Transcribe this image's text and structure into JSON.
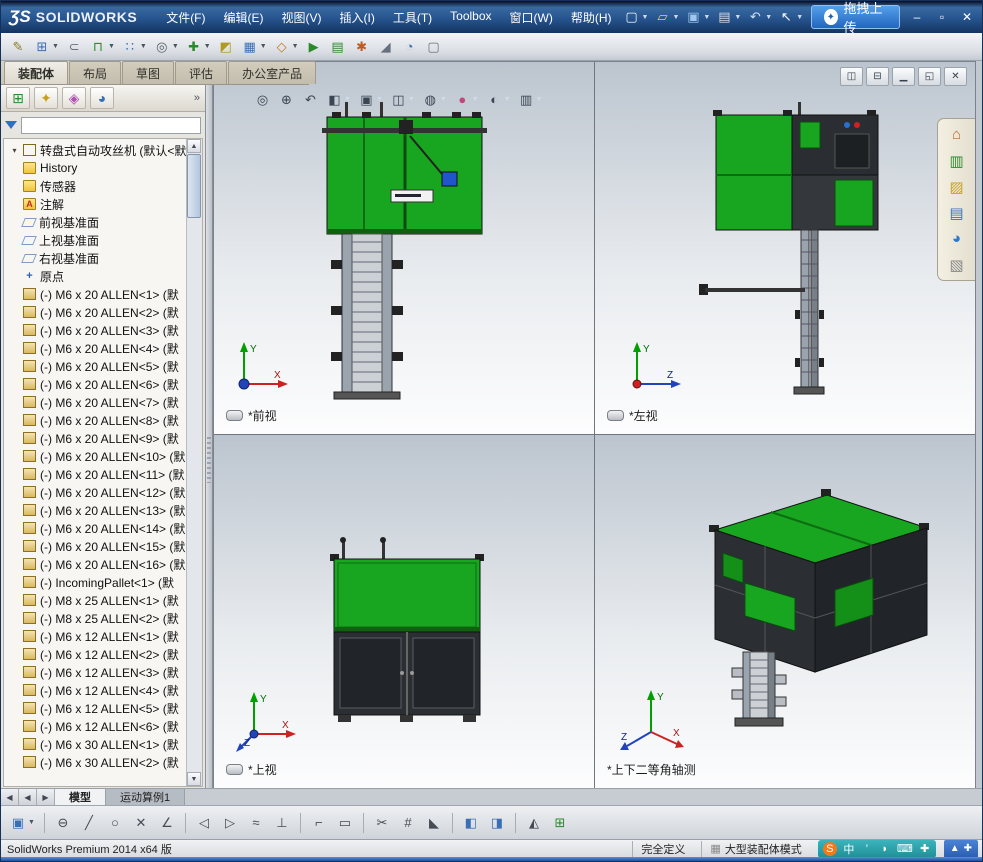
{
  "axes": {
    "x": "X",
    "y": "Y",
    "z": "Z"
  },
  "titlebar": {
    "logo": "ƷS",
    "brand": "SOLIDWORKS",
    "menus": [
      "文件(F)",
      "编辑(E)",
      "视图(V)",
      "插入(I)",
      "工具(T)",
      "Toolbox",
      "窗口(W)",
      "帮助(H)"
    ],
    "quick_tools": [
      {
        "name": "new-document-icon",
        "glyph": "▢",
        "color": "#eef2f8",
        "dropdown": true
      },
      {
        "name": "open-icon",
        "glyph": "▱",
        "color": "#f2cf6a",
        "dropdown": true
      },
      {
        "name": "save-icon",
        "glyph": "▣",
        "color": "#9ec6ee",
        "dropdown": true
      },
      {
        "name": "print-icon",
        "glyph": "▤",
        "color": "#d4dae2",
        "dropdown": true
      },
      {
        "name": "undo-icon",
        "glyph": "↶",
        "color": "#cfe0f2",
        "dropdown": true
      },
      {
        "name": "select-arrow-icon",
        "glyph": "↖",
        "color": "#ffffff",
        "dropdown": true
      }
    ],
    "upload": {
      "label": "拖拽上传",
      "logo_glyph": "✦"
    },
    "window_controls": [
      {
        "name": "minimize-button",
        "glyph": "–"
      },
      {
        "name": "maximize-button",
        "glyph": "▫"
      },
      {
        "name": "close-button",
        "glyph": "✕"
      }
    ]
  },
  "toolbar2": {
    "icons": [
      {
        "name": "edit-component-icon",
        "glyph": "✎",
        "color": "#8a7a20"
      },
      {
        "name": "insert-component-icon",
        "glyph": "⊞",
        "color": "#3a6fb5",
        "dropdown": true
      },
      {
        "name": "attach-icon",
        "glyph": "⊂",
        "color": "#667080"
      },
      {
        "name": "mate-icon",
        "glyph": "⊓",
        "color": "#2a8a2a",
        "dropdown": true
      },
      {
        "name": "component-pattern-icon",
        "glyph": "∷",
        "color": "#3a6fb5",
        "dropdown": true
      },
      {
        "name": "magnify-preview-icon",
        "glyph": "◎",
        "color": "#555f6a",
        "dropdown": true
      },
      {
        "name": "move-component-icon",
        "glyph": "✚",
        "color": "#2a8a2a",
        "dropdown": true
      },
      {
        "name": "show-hidden-icon",
        "glyph": "◩",
        "color": "#b09a20"
      },
      {
        "name": "assembly-features-icon",
        "glyph": "▦",
        "color": "#3a6fb5",
        "dropdown": true
      },
      {
        "name": "reference-geometry-icon",
        "glyph": "◇",
        "color": "#c07a20",
        "dropdown": true
      },
      {
        "name": "motion-study-icon",
        "glyph": "▶",
        "color": "#2a8a2a"
      },
      {
        "name": "bill-of-materials-icon",
        "glyph": "▤",
        "color": "#2a8a2a"
      },
      {
        "name": "exploded-view-icon",
        "glyph": "✱",
        "color": "#c05a20"
      },
      {
        "name": "instant3d-icon",
        "glyph": "◢",
        "color": "#667080"
      },
      {
        "name": "speedpak-icon",
        "glyph": "◔",
        "color": "#3a6fb5"
      },
      {
        "name": "isolate-icon",
        "glyph": "▢",
        "color": "#667080"
      }
    ]
  },
  "command_tabs": {
    "tabs": [
      {
        "label": "装配体",
        "active": true
      },
      {
        "label": "布局"
      },
      {
        "label": "草图"
      },
      {
        "label": "评估"
      },
      {
        "label": "办公室产品"
      }
    ]
  },
  "leftpanel": {
    "manager_tabs": [
      {
        "name": "featuremanager-tab-icon",
        "glyph": "⊞",
        "color": "#2a8a2a"
      },
      {
        "name": "propertymanager-tab-icon",
        "glyph": "✦",
        "color": "#c8a020"
      },
      {
        "name": "configurationmanager-tab-icon",
        "glyph": "◈",
        "color": "#b050b0"
      },
      {
        "name": "displaymanager-tab-icon",
        "glyph": "◕",
        "color": "#3a6fb5"
      }
    ],
    "overflow": "»"
  },
  "feature_tree": {
    "root": {
      "label": "转盘式自动攻丝机 (默认<默认",
      "expander": "▾"
    },
    "items": [
      {
        "icon": "history",
        "label": "History"
      },
      {
        "icon": "sensor",
        "label": "传感器"
      },
      {
        "icon": "annotation",
        "label": "注解"
      },
      {
        "icon": "plane",
        "label": "前视基准面"
      },
      {
        "icon": "plane",
        "label": "上视基准面"
      },
      {
        "icon": "plane",
        "label": "右视基准面"
      },
      {
        "icon": "origin",
        "label": "原点"
      },
      {
        "icon": "part",
        "label": "(-) M6 x 20 ALLEN<1> (默"
      },
      {
        "icon": "part",
        "label": "(-) M6 x 20 ALLEN<2> (默"
      },
      {
        "icon": "part",
        "label": "(-) M6 x 20 ALLEN<3> (默"
      },
      {
        "icon": "part",
        "label": "(-) M6 x 20 ALLEN<4> (默"
      },
      {
        "icon": "part",
        "label": "(-) M6 x 20 ALLEN<5> (默"
      },
      {
        "icon": "part",
        "label": "(-) M6 x 20 ALLEN<6> (默"
      },
      {
        "icon": "part",
        "label": "(-) M6 x 20 ALLEN<7> (默"
      },
      {
        "icon": "part",
        "label": "(-) M6 x 20 ALLEN<8> (默"
      },
      {
        "icon": "part",
        "label": "(-) M6 x 20 ALLEN<9> (默"
      },
      {
        "icon": "part",
        "label": "(-) M6 x 20 ALLEN<10> (默"
      },
      {
        "icon": "part",
        "label": "(-) M6 x 20 ALLEN<11> (默"
      },
      {
        "icon": "part",
        "label": "(-) M6 x 20 ALLEN<12> (默"
      },
      {
        "icon": "part",
        "label": "(-) M6 x 20 ALLEN<13> (默"
      },
      {
        "icon": "part",
        "label": "(-) M6 x 20 ALLEN<14> (默"
      },
      {
        "icon": "part",
        "label": "(-) M6 x 20 ALLEN<15> (默"
      },
      {
        "icon": "part",
        "label": "(-) M6 x 20 ALLEN<16> (默"
      },
      {
        "icon": "part",
        "label": "(-) IncomingPallet<1> (默"
      },
      {
        "icon": "part",
        "label": "(-) M8 x 25 ALLEN<1> (默"
      },
      {
        "icon": "part",
        "label": "(-) M8 x 25 ALLEN<2> (默"
      },
      {
        "icon": "part",
        "label": "(-) M6 x 12 ALLEN<1> (默"
      },
      {
        "icon": "part",
        "label": "(-) M6 x 12 ALLEN<2> (默"
      },
      {
        "icon": "part",
        "label": "(-) M6 x 12 ALLEN<3> (默"
      },
      {
        "icon": "part",
        "label": "(-) M6 x 12 ALLEN<4> (默"
      },
      {
        "icon": "part",
        "label": "(-) M6 x 12 ALLEN<5> (默"
      },
      {
        "icon": "part",
        "label": "(-) M6 x 12 ALLEN<6> (默"
      },
      {
        "icon": "part",
        "label": "(-) M6 x 30 ALLEN<1> (默"
      },
      {
        "icon": "part",
        "label": "(-) M6 x 30 ALLEN<2> (默"
      }
    ]
  },
  "viewport_hud": {
    "icons": [
      {
        "name": "zoom-fit-icon",
        "glyph": "◎"
      },
      {
        "name": "zoom-area-icon",
        "glyph": "⊕"
      },
      {
        "name": "previous-view-icon",
        "glyph": "↶"
      },
      {
        "name": "section-view-icon",
        "glyph": "◧",
        "dropdown": true
      },
      {
        "name": "view-orientation-icon",
        "glyph": "▣",
        "dropdown": true
      },
      {
        "name": "display-style-icon",
        "glyph": "◫",
        "dropdown": true
      },
      {
        "name": "hide-show-items-icon",
        "glyph": "◍",
        "dropdown": true
      },
      {
        "name": "edit-appearance-icon",
        "glyph": "●",
        "color": "#c04878",
        "dropdown": true
      },
      {
        "name": "apply-scene-icon",
        "glyph": "◐",
        "dropdown": true
      },
      {
        "name": "view-settings-icon",
        "glyph": "▥",
        "dropdown": true
      }
    ]
  },
  "viewport_controls": {
    "icons": [
      {
        "name": "split-horizontal-icon",
        "glyph": "◫"
      },
      {
        "name": "split-vertical-icon",
        "glyph": "⊟"
      },
      {
        "name": "minimize-viewport-icon",
        "glyph": "▁"
      },
      {
        "name": "restore-viewport-icon",
        "glyph": "◱"
      },
      {
        "name": "close-viewport-icon",
        "glyph": "✕"
      }
    ]
  },
  "viewports": [
    {
      "label": "*前视"
    },
    {
      "label": "*左视"
    },
    {
      "label": "*上视"
    },
    {
      "label": "*上下二等角轴测"
    }
  ],
  "taskpane": {
    "icons": [
      {
        "name": "resources-home-icon",
        "glyph": "⌂",
        "color": "#c06820"
      },
      {
        "name": "design-library-icon",
        "glyph": "▥",
        "color": "#2a8a2a"
      },
      {
        "name": "file-explorer-icon",
        "glyph": "▨",
        "color": "#c8a020"
      },
      {
        "name": "view-palette-icon",
        "glyph": "▤",
        "color": "#3a6fb5"
      },
      {
        "name": "appearances-icon",
        "glyph": "◕",
        "color": "#2a7ad0"
      },
      {
        "name": "custom-properties-icon",
        "glyph": "▧",
        "color": "#888888"
      }
    ]
  },
  "model_tabs": {
    "nav": [
      {
        "name": "tab-scroll-first-icon",
        "glyph": "◀"
      },
      {
        "name": "tab-scroll-prev-icon",
        "glyph": "◀"
      },
      {
        "name": "tab-scroll-next-icon",
        "glyph": "▶"
      }
    ],
    "tabs": [
      {
        "label": "模型",
        "active": true
      },
      {
        "label": "运动算例1"
      }
    ]
  },
  "sketch_toolbar": {
    "icons": [
      {
        "name": "save-icon",
        "glyph": "▣",
        "color": "#3a6fb5",
        "dropdown": true
      },
      {
        "name": "separator",
        "sep": true
      },
      {
        "name": "slot-icon",
        "glyph": "⊖",
        "color": "#454c55"
      },
      {
        "name": "line-icon",
        "glyph": "╱",
        "color": "#454c55"
      },
      {
        "name": "circle-icon",
        "glyph": "○",
        "color": "#454c55"
      },
      {
        "name": "cross-curve-icon",
        "glyph": "✕",
        "color": "#454c55"
      },
      {
        "name": "angle-line-icon",
        "glyph": "∠",
        "color": "#454c55"
      },
      {
        "name": "separator",
        "sep": true
      },
      {
        "name": "arrow-left-icon",
        "glyph": "◁",
        "color": "#454c55"
      },
      {
        "name": "arrow-right-icon",
        "glyph": "▷",
        "color": "#454c55"
      },
      {
        "name": "spline-icon",
        "glyph": "≈",
        "color": "#454c55"
      },
      {
        "name": "perpendicular-icon",
        "glyph": "⊥",
        "color": "#454c55"
      },
      {
        "name": "separator",
        "sep": true
      },
      {
        "name": "corner-snap-icon",
        "glyph": "⌐",
        "color": "#454c55"
      },
      {
        "name": "dashed-rect-icon",
        "glyph": "▭",
        "color": "#454c55"
      },
      {
        "name": "separator",
        "sep": true
      },
      {
        "name": "trim-icon",
        "glyph": "✂",
        "color": "#454c55"
      },
      {
        "name": "grid-icon",
        "glyph": "#",
        "color": "#454c55"
      },
      {
        "name": "triangle-icon",
        "glyph": "◣",
        "color": "#454c55"
      },
      {
        "name": "separator",
        "sep": true
      },
      {
        "name": "view-cube-icon",
        "glyph": "◧",
        "color": "#3a6fb5"
      },
      {
        "name": "split-cube-icon",
        "glyph": "◨",
        "color": "#3a6fb5"
      },
      {
        "name": "separator",
        "sep": true
      },
      {
        "name": "evaluate-icon",
        "glyph": "◭",
        "color": "#454c55"
      },
      {
        "name": "table-icon",
        "glyph": "⊞",
        "color": "#2a8a2a"
      }
    ]
  },
  "statusbar": {
    "left": "SolidWorks Premium 2014 x64 版",
    "defined": "完全定义",
    "mode": "大型装配体模式",
    "ime_icons": [
      {
        "name": "sogou-icon",
        "glyph": "S",
        "fg": "#ffffff",
        "bg": "#f07a1a"
      },
      {
        "name": "chinese-mode-icon",
        "glyph": "中"
      },
      {
        "name": "punctuation-icon",
        "glyph": "’"
      },
      {
        "name": "shape-mode-icon",
        "glyph": "◗"
      },
      {
        "name": "softkeyboard-icon",
        "glyph": "⌨"
      },
      {
        "name": "ime-tool-icon",
        "glyph": "✚"
      }
    ],
    "tray_icons": [
      {
        "name": "tray-upload-icon",
        "glyph": "▲"
      },
      {
        "name": "tray-pin-icon",
        "glyph": "✚"
      }
    ]
  }
}
